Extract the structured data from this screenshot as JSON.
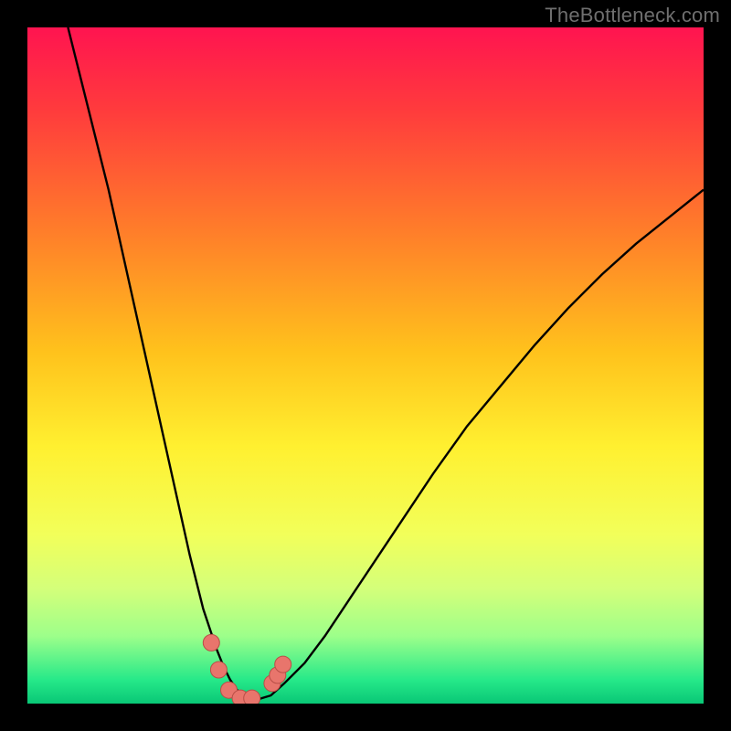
{
  "watermark": "TheBottleneck.com",
  "colors": {
    "frame": "#000000",
    "watermark": "#6f6f6f",
    "curve": "#000000",
    "marker_fill": "#e8756c",
    "marker_stroke": "#b84f47",
    "gradient_stops": [
      {
        "offset": 0.0,
        "color": "#ff1450"
      },
      {
        "offset": 0.12,
        "color": "#ff3a3d"
      },
      {
        "offset": 0.3,
        "color": "#ff7d2a"
      },
      {
        "offset": 0.48,
        "color": "#ffc21c"
      },
      {
        "offset": 0.62,
        "color": "#fff030"
      },
      {
        "offset": 0.75,
        "color": "#f2ff5a"
      },
      {
        "offset": 0.83,
        "color": "#d4ff7a"
      },
      {
        "offset": 0.9,
        "color": "#9dff8a"
      },
      {
        "offset": 0.965,
        "color": "#26e989"
      },
      {
        "offset": 1.0,
        "color": "#09c776"
      }
    ]
  },
  "chart_data": {
    "type": "line",
    "title": "",
    "xlabel": "",
    "ylabel": "",
    "xlim": [
      0,
      100
    ],
    "ylim": [
      0,
      100
    ],
    "grid": false,
    "legend": false,
    "series": [
      {
        "name": "curve",
        "x": [
          6,
          8,
          10,
          12,
          14,
          16,
          18,
          20,
          22,
          24,
          25,
          26,
          27,
          28,
          29,
          30,
          31,
          32,
          33,
          34,
          36,
          38,
          41,
          44,
          48,
          52,
          56,
          60,
          65,
          70,
          75,
          80,
          85,
          90,
          95,
          100
        ],
        "y": [
          100,
          92,
          84,
          76,
          67,
          58,
          49,
          40,
          31,
          22,
          18,
          14,
          11,
          8,
          5.5,
          3.5,
          2,
          1.1,
          0.6,
          0.6,
          1.2,
          3,
          6,
          10,
          16,
          22,
          28,
          34,
          41,
          47,
          53,
          58.5,
          63.5,
          68,
          72,
          76
        ]
      }
    ],
    "markers": {
      "name": "highlighted-points",
      "x": [
        27.2,
        28.3,
        29.8,
        31.5,
        33.2,
        36.2,
        37.0,
        37.8
      ],
      "y": [
        9.0,
        5.0,
        2.0,
        0.8,
        0.8,
        3.0,
        4.2,
        5.8
      ]
    }
  }
}
